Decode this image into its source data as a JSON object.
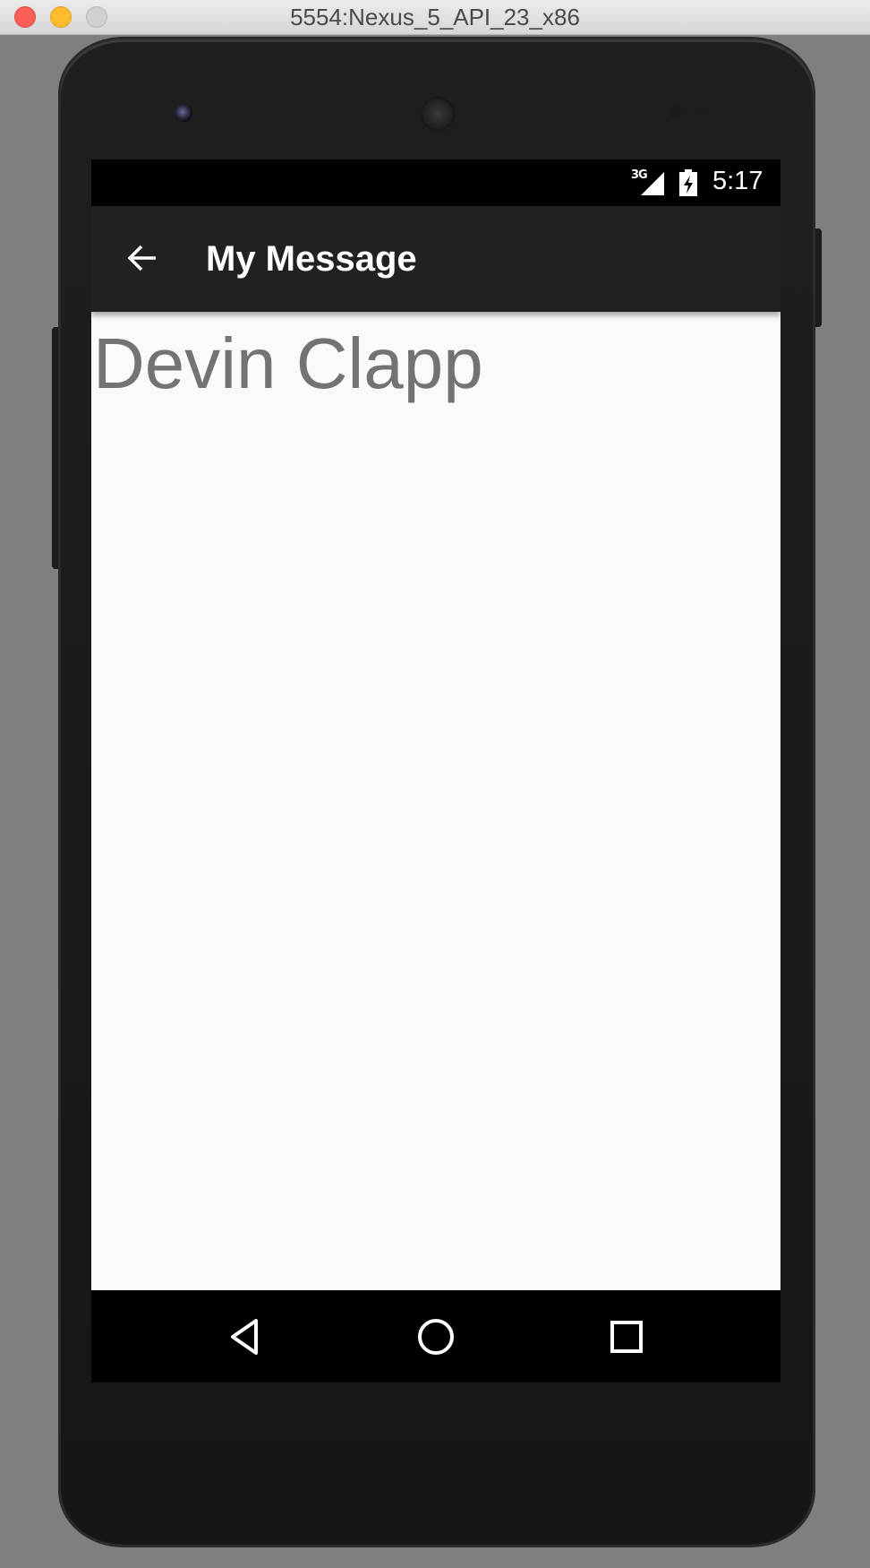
{
  "window": {
    "title": "5554:Nexus_5_API_23_x86"
  },
  "status_bar": {
    "network": "3G",
    "time": "5:17"
  },
  "toolbar": {
    "title": "My Message",
    "back_icon": "arrow-back-icon"
  },
  "content": {
    "contact_name": "Devin Clapp"
  },
  "nav_bar": {
    "back_icon": "triangle-back-icon",
    "home_icon": "circle-home-icon",
    "recents_icon": "square-recents-icon"
  },
  "colors": {
    "toolbar": "#212121",
    "screen_background": "#fafafa",
    "name_text": "#737373",
    "status_bar": "#000000"
  }
}
